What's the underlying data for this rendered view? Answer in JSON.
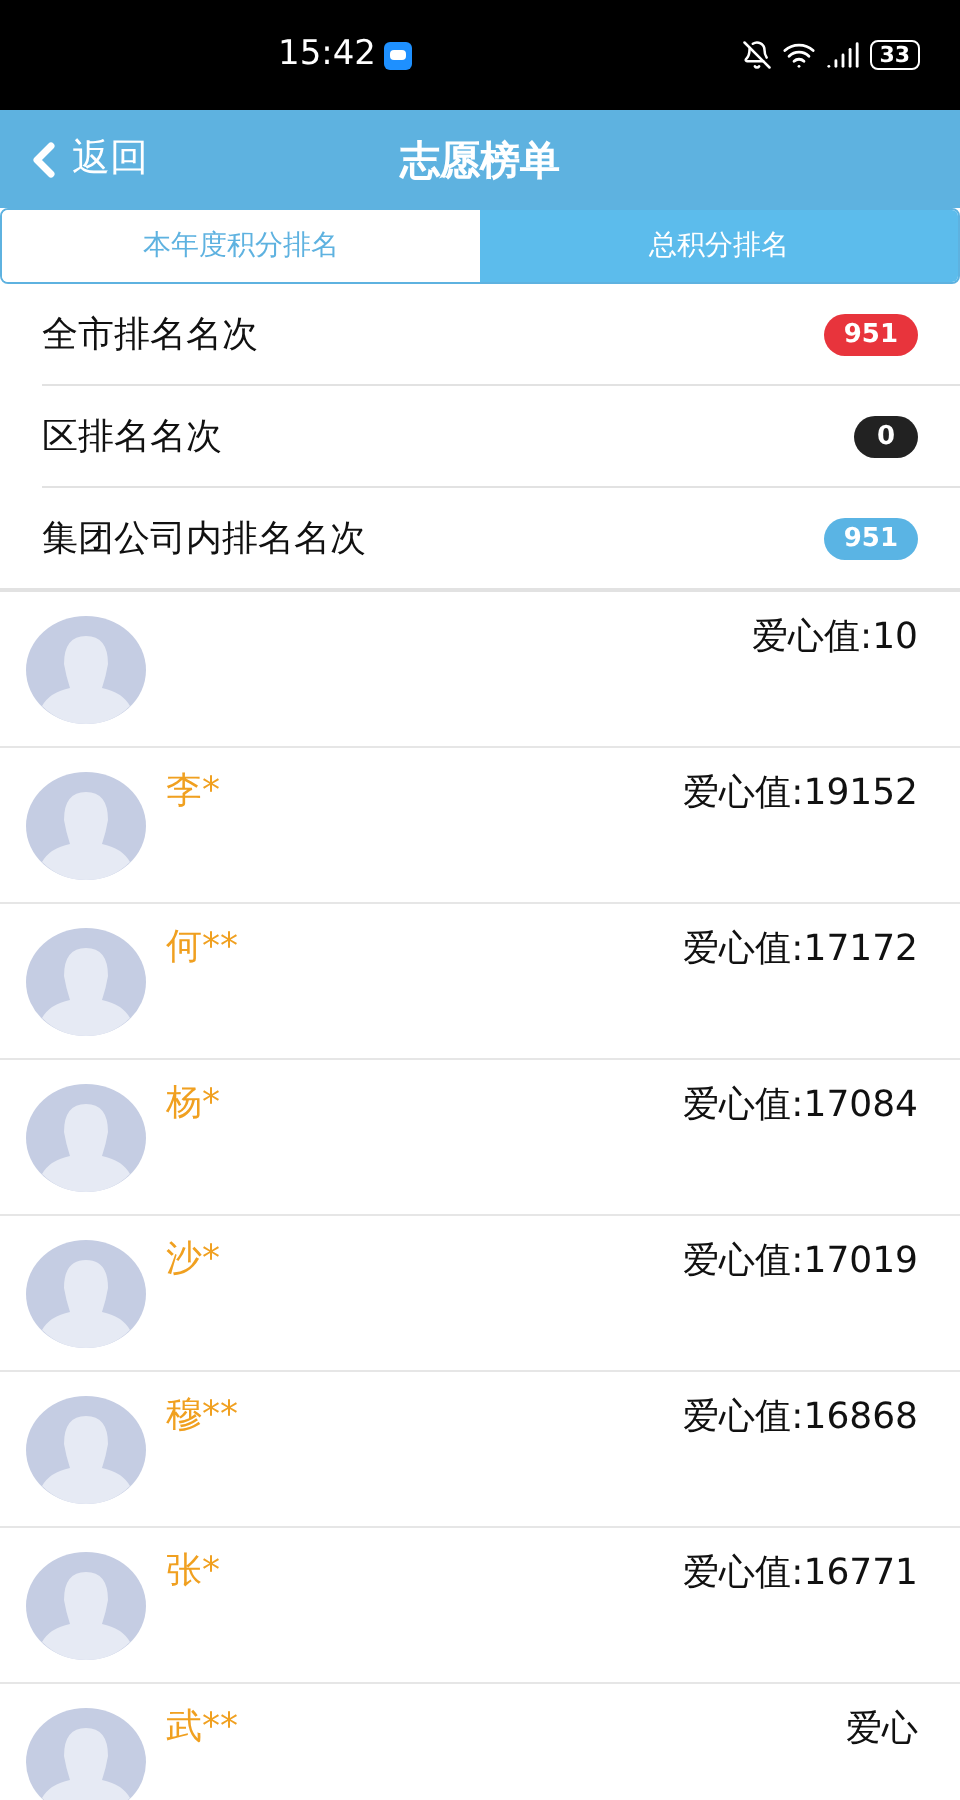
{
  "status_bar": {
    "time": "15:42",
    "battery": "33"
  },
  "header": {
    "back": "返回",
    "title": "志愿榜单"
  },
  "tabs": [
    {
      "label": "本年度积分排名",
      "selected": true
    },
    {
      "label": "总积分排名",
      "selected": false
    }
  ],
  "ranks": [
    {
      "label": "全市排名名次",
      "value": "951",
      "color": "#e8343c"
    },
    {
      "label": "区排名名次",
      "value": "0",
      "color": "#222222"
    },
    {
      "label": "集团公司内排名名次",
      "value": "951",
      "color": "#5ab4e4"
    }
  ],
  "volunteers": [
    {
      "score": "爱心值:10"
    },
    {
      "name": "李*",
      "score": "爱心值:19152"
    },
    {
      "name": "何**",
      "score": "爱心值:17172"
    },
    {
      "name": "杨*",
      "score": "爱心值:17084"
    },
    {
      "name": "沙*",
      "score": "爱心值:17019"
    },
    {
      "name": "穆**",
      "score": "爱心值:16868"
    },
    {
      "name": "张*",
      "score": "爱心值:16771"
    },
    {
      "name": "武**",
      "score": "爱心"
    }
  ]
}
